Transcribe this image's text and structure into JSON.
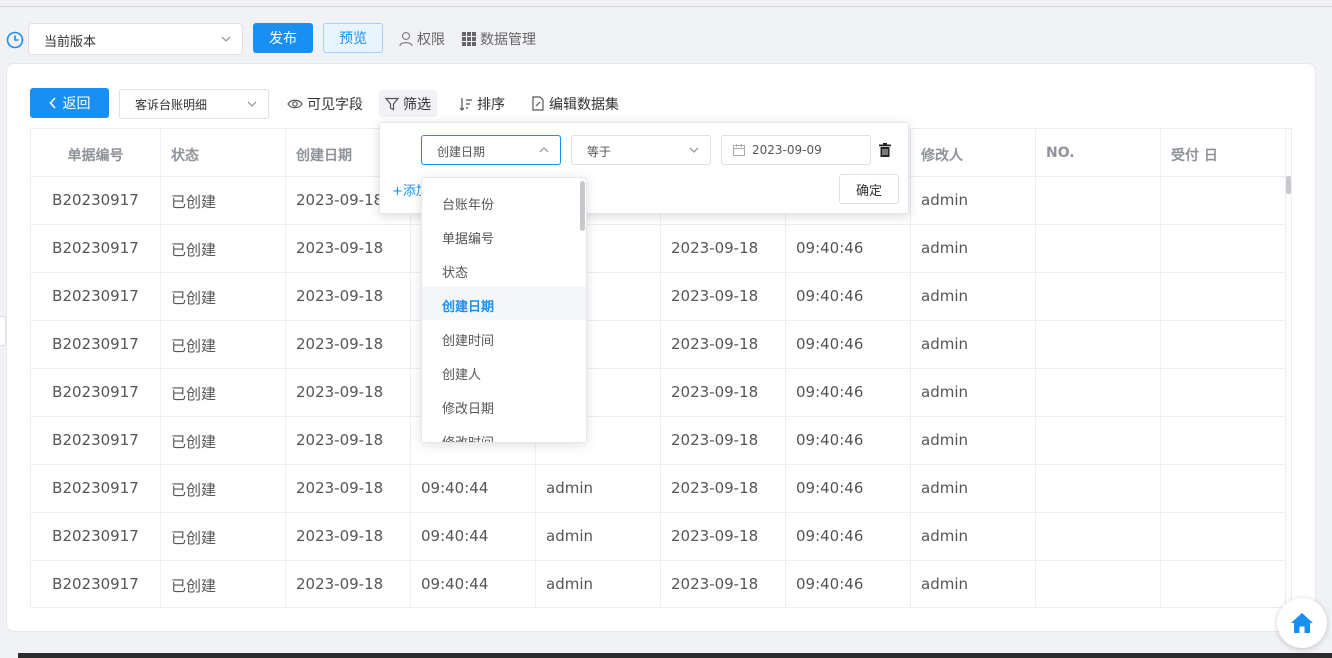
{
  "toolbar": {
    "version_value": "当前版本",
    "publish_label": "发布",
    "preview_label": "预览",
    "permission_label": "权限",
    "data_manage_label": "数据管理"
  },
  "view": {
    "back_label": "返回",
    "dataset_value": "客诉台账明细",
    "visible_fields_label": "可见字段",
    "filter_label": "筛选",
    "sort_label": "排序",
    "edit_dataset_label": "编辑数据集"
  },
  "table": {
    "columns": [
      "单据编号",
      "状态",
      "创建日期",
      "",
      "",
      "",
      "",
      "修改人",
      "NO.",
      "受付 日"
    ],
    "rows": [
      [
        "B20230917",
        "已创建",
        "2023-09-18",
        "",
        "",
        "",
        "",
        "admin",
        "",
        ""
      ],
      [
        "B20230917",
        "已创建",
        "2023-09-18",
        "",
        "",
        "2023-09-18",
        "09:40:46",
        "admin",
        "",
        ""
      ],
      [
        "B20230917",
        "已创建",
        "2023-09-18",
        "",
        "",
        "2023-09-18",
        "09:40:46",
        "admin",
        "",
        ""
      ],
      [
        "B20230917",
        "已创建",
        "2023-09-18",
        "",
        "",
        "2023-09-18",
        "09:40:46",
        "admin",
        "",
        ""
      ],
      [
        "B20230917",
        "已创建",
        "2023-09-18",
        "",
        "",
        "2023-09-18",
        "09:40:46",
        "admin",
        "",
        ""
      ],
      [
        "B20230917",
        "已创建",
        "2023-09-18",
        "",
        "",
        "2023-09-18",
        "09:40:46",
        "admin",
        "",
        ""
      ],
      [
        "B20230917",
        "已创建",
        "2023-09-18",
        "09:40:44",
        "admin",
        "2023-09-18",
        "09:40:46",
        "admin",
        "",
        ""
      ],
      [
        "B20230917",
        "已创建",
        "2023-09-18",
        "09:40:44",
        "admin",
        "2023-09-18",
        "09:40:46",
        "admin",
        "",
        ""
      ],
      [
        "B20230917",
        "已创建",
        "2023-09-18",
        "09:40:44",
        "admin",
        "2023-09-18",
        "09:40:46",
        "admin",
        "",
        ""
      ]
    ]
  },
  "filter": {
    "field_value": "创建日期",
    "operator_value": "等于",
    "date_value": "2023-09-09",
    "add_label": "+添加",
    "ok_label": "确定"
  },
  "dropdown": {
    "items": [
      "台账年份",
      "单据编号",
      "状态",
      "创建日期",
      "创建时间",
      "创建人",
      "修改日期",
      "修改时间"
    ],
    "selected": "创建日期"
  },
  "colors": {
    "accent": "#1a8ff2",
    "header_text": "#909399",
    "border": "#ebeef5"
  }
}
